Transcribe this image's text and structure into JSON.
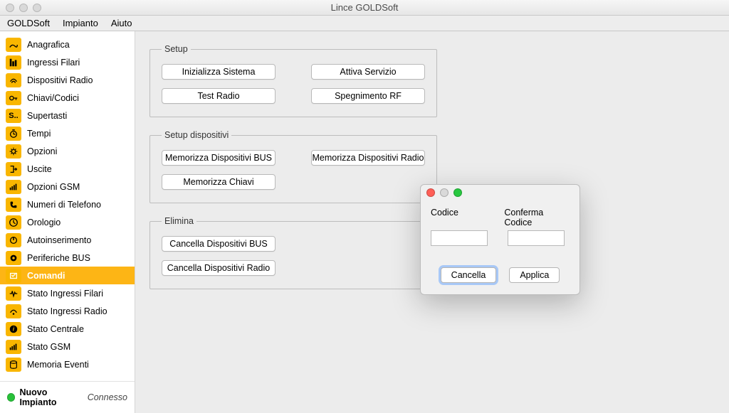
{
  "window": {
    "title": "Lince GOLDSoft"
  },
  "menu": {
    "app": "GOLDSoft",
    "impianto": "Impianto",
    "aiuto": "Aiuto"
  },
  "sidebar": {
    "items": [
      {
        "label": "Anagrafica"
      },
      {
        "label": "Ingressi Filari"
      },
      {
        "label": "Dispositivi Radio"
      },
      {
        "label": "Chiavi/Codici"
      },
      {
        "label": "Supertasti"
      },
      {
        "label": "Tempi"
      },
      {
        "label": "Opzioni"
      },
      {
        "label": "Uscite"
      },
      {
        "label": "Opzioni GSM"
      },
      {
        "label": "Numeri di Telefono"
      },
      {
        "label": "Orologio"
      },
      {
        "label": "Autoinserimento"
      },
      {
        "label": "Periferiche BUS"
      },
      {
        "label": "Comandi"
      },
      {
        "label": "Stato Ingressi Filari"
      },
      {
        "label": "Stato Ingressi Radio"
      },
      {
        "label": "Stato Centrale"
      },
      {
        "label": "Stato GSM"
      },
      {
        "label": "Memoria Eventi"
      }
    ],
    "footer": {
      "name": "Nuovo Impianto",
      "state": "Connesso"
    }
  },
  "groups": {
    "setup": {
      "legend": "Setup",
      "init": "Inizializza Sistema",
      "attiva": "Attiva Servizio",
      "test": "Test Radio",
      "spegn": "Spegnimento RF"
    },
    "setupDisp": {
      "legend": "Setup dispositivi",
      "memBus": "Memorizza Dispositivi BUS",
      "memRadio": "Memorizza Dispositivi Radio",
      "memChiavi": "Memorizza Chiavi"
    },
    "elimina": {
      "legend": "Elimina",
      "cancBus": "Cancella Dispositivi BUS",
      "cancRadio": "Cancella Dispositivi Radio"
    }
  },
  "dialog": {
    "codiceLabel": "Codice",
    "confermaLabel": "Conferma Codice",
    "codiceValue": "",
    "confermaValue": "",
    "cancel": "Cancella",
    "apply": "Applica"
  }
}
